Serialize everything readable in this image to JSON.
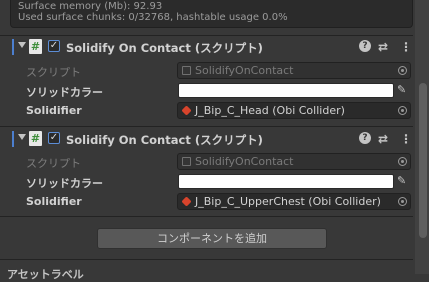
{
  "info": {
    "line1": "Surface memory (Mb): 92.93",
    "line2": "Used surface chunks: 0/32768, hashtable usage 0.0%"
  },
  "components": [
    {
      "title": "Solidify On Contact (スクリプト)",
      "enabled": true,
      "script_label": "スクリプト",
      "script_value": "SolidifyOnContact",
      "color_label": "ソリッドカラー",
      "color_value": "#FFFFFF",
      "solidifier_label": "Solidifier",
      "solidifier_value": "J_Bip_C_Head (Obi Collider)"
    },
    {
      "title": "Solidify On Contact (スクリプト)",
      "enabled": true,
      "script_label": "スクリプト",
      "script_value": "SolidifyOnContact",
      "color_label": "ソリッドカラー",
      "color_value": "#FFFFFF",
      "solidifier_label": "Solidifier",
      "solidifier_value": "J_Bip_C_UpperChest (Obi Collider)"
    }
  ],
  "add_component_label": "コンポーネントを追加",
  "footer_label": "アセットラベル",
  "icons": {
    "script": "script-icon",
    "help": "help-icon",
    "presets": "presets-icon",
    "menu": "kebab-menu-icon",
    "picker": "object-picker-icon",
    "eyedropper": "eyedropper-icon",
    "collider": "obi-collider-icon"
  },
  "colors": {
    "accent": "#4c7fcf",
    "background": "#383838"
  }
}
